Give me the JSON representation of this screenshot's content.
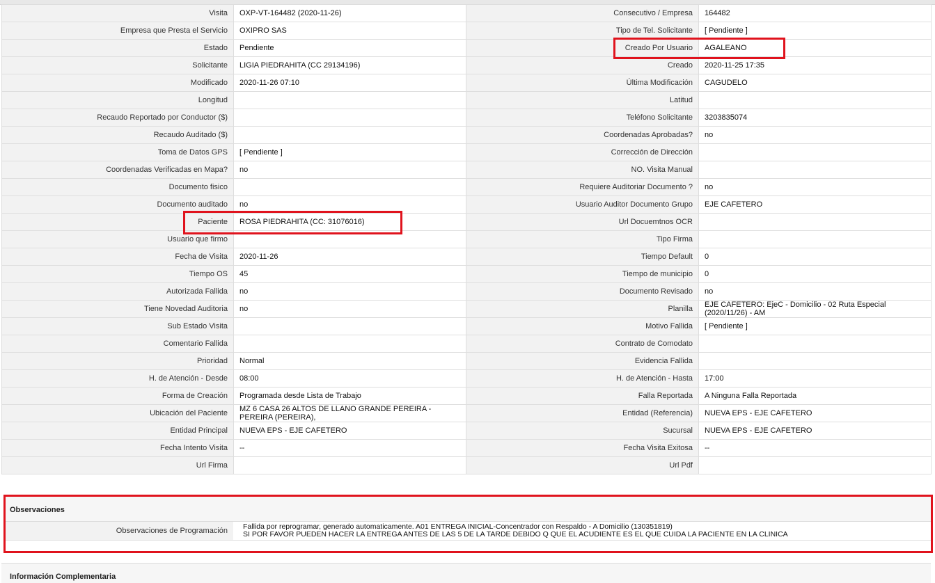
{
  "rows": [
    {
      "l1": "Visita",
      "v1": "OXP-VT-164482 (2020-11-26)",
      "l2": "Consecutivo / Empresa",
      "v2": "164482"
    },
    {
      "l1": "Empresa que Presta el Servicio",
      "v1": "OXIPRO SAS",
      "l2": "Tipo de Tel. Solicitante",
      "v2": "[ Pendiente ]"
    },
    {
      "l1": "Estado",
      "v1": "Pendiente",
      "l2": "Creado Por Usuario",
      "v2": "AGALEANO"
    },
    {
      "l1": "Solicitante",
      "v1": "LIGIA PIEDRAHITA (CC 29134196)",
      "l2": "Creado",
      "v2": "2020-11-25 17:35"
    },
    {
      "l1": "Modificado",
      "v1": "2020-11-26 07:10",
      "l2": "Última Modificación",
      "v2": " CAGUDELO"
    },
    {
      "l1": "Longitud",
      "v1": "",
      "l2": "Latitud",
      "v2": ""
    },
    {
      "l1": "Recaudo Reportado por Conductor ($)",
      "v1": "",
      "l2": "Teléfono Solicitante",
      "v2": "3203835074"
    },
    {
      "l1": "Recaudo Auditado ($)",
      "v1": "",
      "l2": "Coordenadas Aprobadas?",
      "v2": " no"
    },
    {
      "l1": "Toma de Datos GPS",
      "v1": "[ Pendiente ]",
      "l2": "Corrección de Dirección",
      "v2": ""
    },
    {
      "l1": "Coordenadas Verificadas en Mapa?",
      "v1": " no",
      "l2": "NO. Visita Manual",
      "v2": ""
    },
    {
      "l1": "Documento fisico",
      "v1": "",
      "l2": "Requiere Auditoriar Documento ?",
      "v2": " no"
    },
    {
      "l1": "Documento auditado",
      "v1": " no",
      "l2": "Usuario Auditor Documento Grupo",
      "v2": "EJE CAFETERO"
    },
    {
      "l1": "Paciente",
      "v1": "ROSA PIEDRAHITA (CC: 31076016)",
      "l2": "Url Docuemtnos OCR",
      "v2": ""
    },
    {
      "l1": "Usuario que firmo",
      "v1": "",
      "l2": "Tipo Firma",
      "v2": ""
    },
    {
      "l1": "Fecha de Visita",
      "v1": " 2020-11-26",
      "l2": "Tiempo Default",
      "v2": "0"
    },
    {
      "l1": "Tiempo OS",
      "v1": "45",
      "l2": "Tiempo de municipio",
      "v2": "0"
    },
    {
      "l1": "Autorizada Fallida",
      "v1": " no",
      "l2": "Documento Revisado",
      "v2": " no"
    },
    {
      "l1": "Tiene Novedad Auditoria",
      "v1": " no",
      "l2": "Planilla",
      "v2": "EJE CAFETERO: EjeC - Domicilio - 02 Ruta Especial (2020/11/26) - AM"
    },
    {
      "l1": "Sub Estado Visita",
      "v1": "",
      "l2": "Motivo Fallida",
      "v2": "[ Pendiente ]"
    },
    {
      "l1": "Comentario Fallida",
      "v1": "",
      "l2": "Contrato de Comodato",
      "v2": ""
    },
    {
      "l1": "Prioridad",
      "v1": "Normal",
      "l2": "Evidencia Fallida",
      "v2": ""
    },
    {
      "l1": "H. de Atención - Desde",
      "v1": "08:00",
      "l2": "H. de Atención - Hasta",
      "v2": "17:00"
    },
    {
      "l1": "Forma de Creación",
      "v1": "Programada desde Lista de Trabajo",
      "l2": "Falla Reportada",
      "v2": "A Ninguna Falla Reportada"
    },
    {
      "l1": "Ubicación del Paciente",
      "v1": "MZ 6 CASA 26 ALTOS DE LLANO GRANDE PEREIRA - PEREIRA (PEREIRA),",
      "l2": "Entidad (Referencia)",
      "v2": "NUEVA EPS - EJE CAFETERO"
    },
    {
      "l1": "Entidad Principal",
      "v1": "NUEVA EPS - EJE CAFETERO",
      "l2": "Sucursal",
      "v2": "NUEVA EPS - EJE CAFETERO"
    },
    {
      "l1": "Fecha Intento Visita",
      "v1": " --",
      "l2": "Fecha Visita Exitosa",
      "v2": " --"
    },
    {
      "l1": "Url Firma",
      "v1": "",
      "l2": "Url Pdf",
      "v2": ""
    }
  ],
  "observaciones": {
    "title": "Observaciones",
    "label": "Observaciones de Programación",
    "line1": "Fallida por reprogramar, generado automaticamente. A01 ENTREGA INICIAL-Concentrador con Respaldo - A Domicilio (130351819)",
    "line2": "SI POR FAVOR PUEDEN HACER LA ENTREGA ANTES DE LAS 5 DE LA TARDE DEBIDO Q QUE EL ACUDIENTE ES EL QUE CUIDA LA PACIENTE EN LA CLINICA"
  },
  "info_title": "Información Complementaria",
  "colors": {
    "highlight": "#e0131d",
    "label_bg": "#f2f2f2",
    "border": "#dedede"
  }
}
